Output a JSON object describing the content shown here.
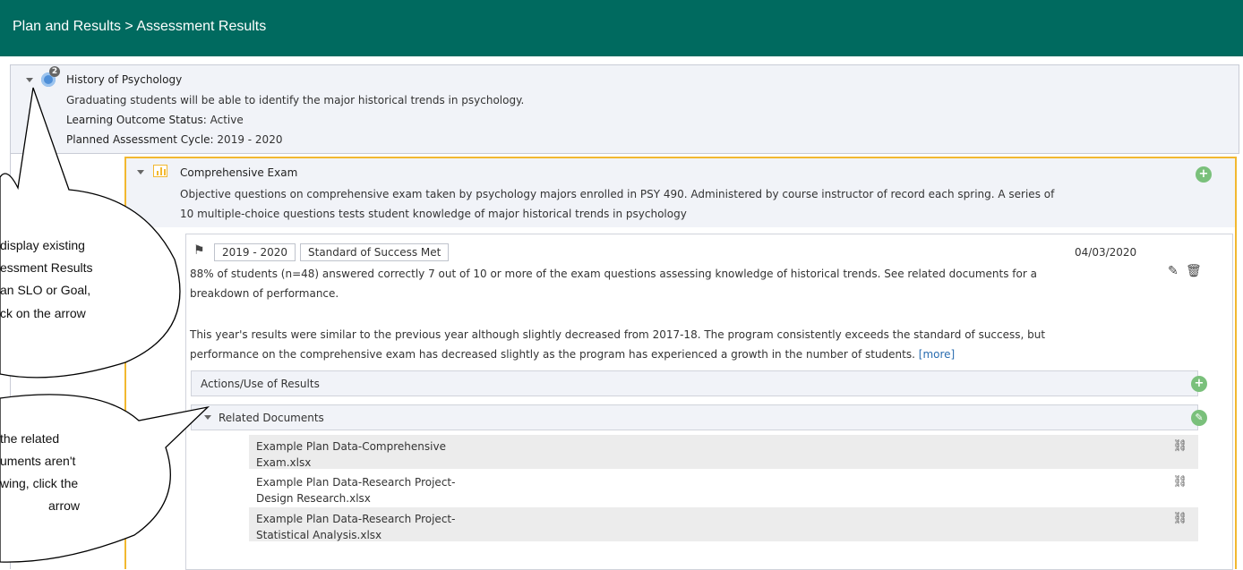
{
  "header": {
    "breadcrumb": "Plan and Results > Assessment Results",
    "bg_color": "#006a5f"
  },
  "slo": {
    "badge_count": "2",
    "title": "History of Psychology",
    "description": "Graduating students will be able to identify the major historical trends in psychology.",
    "status_label": "Learning Outcome Status:",
    "status_value": "Active",
    "cycle_label": "Planned Assessment Cycle:",
    "cycle_value": "2019 - 2020"
  },
  "measure": {
    "title": "Comprehensive Exam",
    "description_1": "Objective questions on comprehensive exam taken by psychology majors enrolled in PSY 490. Administered by course instructor of record each spring. A series of",
    "description_2": "10 multiple-choice questions tests student knowledge of major historical trends in psychology",
    "accent_color": "#f2b830"
  },
  "result": {
    "cycle_tag": "2019 - 2020",
    "status_tag": "Standard of Success Met",
    "date": "04/03/2020",
    "summary_1": "88% of students (n=48) answered correctly 7 out of 10 or more of the exam questions assessing knowledge of historical trends. See related documents for a",
    "summary_2": "breakdown of performance.",
    "analysis_1": "This year's results were similar to the previous year although slightly decreased from 2017-18. The program consistently exceeds the standard of success, but",
    "analysis_2": "performance on the comprehensive exam has decreased slightly as the program has experienced a growth in the number of students.",
    "more_link": "[more]",
    "actions_label": "Actions/Use of Results",
    "related_label": "Related Documents"
  },
  "documents": [
    {
      "line1": "Example Plan Data-Comprehensive",
      "line2": "Exam.xlsx"
    },
    {
      "line1": "Example Plan Data-Research Project-",
      "line2": "Design Research.xlsx"
    },
    {
      "line1": "Example Plan Data-Research Project-",
      "line2": "Statistical Analysis.xlsx"
    }
  ],
  "callouts": {
    "top": [
      "display existing",
      "essment Results",
      "an SLO or Goal,",
      "ck on the arrow"
    ],
    "bottom": [
      "the related",
      "uments aren't",
      "wing, click the",
      "arrow"
    ]
  }
}
